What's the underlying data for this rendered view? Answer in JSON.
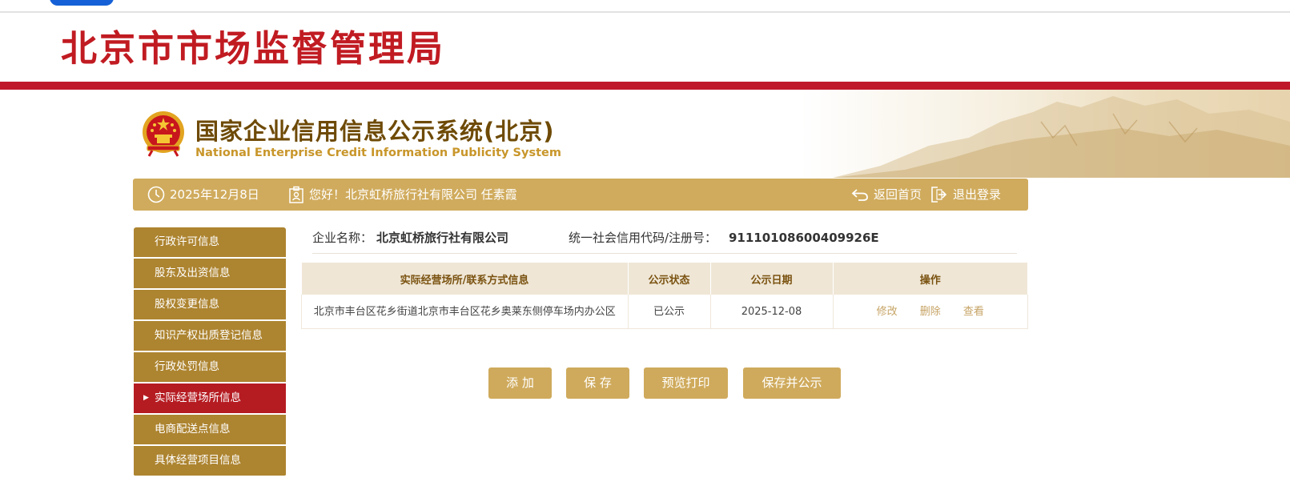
{
  "header": {
    "agency_title": "北京市市场监督管理局",
    "system_name_cn": "国家企业信用信息公示系统(北京)",
    "system_name_en": "National Enterprise Credit Information Publicity System"
  },
  "infobar": {
    "date": "2025年12月8日",
    "greeting": "您好！北京虹桥旅行社有限公司 任素霞",
    "home_label": "返回首页",
    "logout_label": "退出登录"
  },
  "sidebar": {
    "items": [
      {
        "label": "行政许可信息"
      },
      {
        "label": "股东及出资信息"
      },
      {
        "label": "股权变更信息"
      },
      {
        "label": "知识产权出质登记信息"
      },
      {
        "label": "行政处罚信息"
      },
      {
        "label": "实际经营场所信息",
        "active": true
      },
      {
        "label": "电商配送点信息"
      },
      {
        "label": "具体经营项目信息"
      }
    ]
  },
  "company": {
    "name_label": "企业名称：",
    "name": "北京虹桥旅行社有限公司",
    "code_label": "统一社会信用代码/注册号：",
    "code": "91110108600409926E"
  },
  "table": {
    "headers": [
      "实际经营场所/联系方式信息",
      "公示状态",
      "公示日期",
      "操作"
    ],
    "rows": [
      {
        "address": "北京市丰台区花乡街道北京市丰台区花乡奥莱东侧停车场内办公区",
        "status": "已公示",
        "date": "2025-12-08",
        "actions": [
          "修改",
          "删除",
          "查看"
        ]
      }
    ]
  },
  "buttons": {
    "add": "添 加",
    "save": "保 存",
    "preview_print": "预览打印",
    "save_publish": "保存并公示"
  },
  "icons": [
    "clock-icon",
    "user-card-icon",
    "return-icon",
    "logout-icon",
    "national-emblem-icon"
  ],
  "colors": {
    "brand_red": "#c0182b",
    "gold": "#d0ab5d",
    "sidebar": "#ad8430",
    "sidebar_active": "#b51c22"
  }
}
